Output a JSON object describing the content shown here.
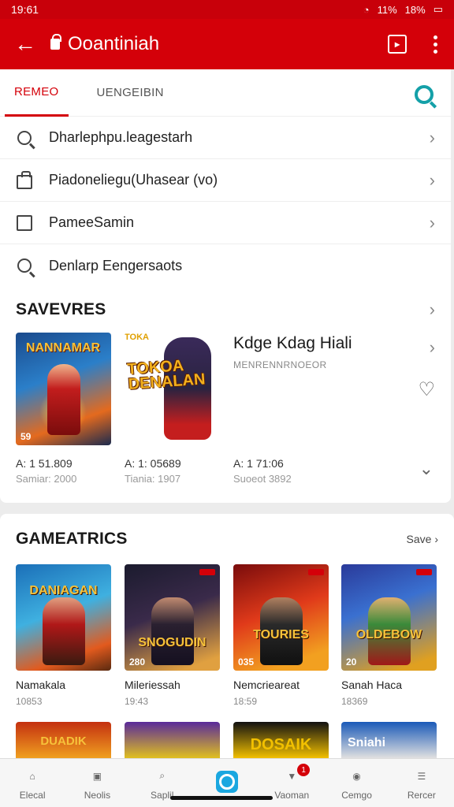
{
  "status": {
    "time": "19:61",
    "sig": "11%",
    "battery": "18%"
  },
  "appbar": {
    "title": "Ooantiniah"
  },
  "tabs": [
    {
      "label": "REMEO"
    },
    {
      "label": "UENGEIBIN"
    }
  ],
  "search_rows": [
    {
      "icon": "search-icon",
      "label": "Dharlephpu.leagestarh"
    },
    {
      "icon": "bag-icon",
      "label": "Piadoneliegu(Uhasear (vo)"
    },
    {
      "icon": "square-icon",
      "label": "PameeSamin"
    },
    {
      "icon": "search-icon",
      "label": "Denlarp Eengersaots"
    }
  ],
  "featured": {
    "heading": "SAVEVRES",
    "thumb1_title": "NANNAMAR",
    "thumb1_badge": "59",
    "thumb2_small": "TOKA",
    "thumb2_logo": "TOKOA DENALAN",
    "name": "Kdge Kdag Hiali",
    "subtitle": "MENRENNRNOEOR",
    "stats": [
      {
        "a": "A: 1 51.809",
        "b": "Samiar: 2000"
      },
      {
        "a": "A: 1: 05689",
        "b": "Tiania: 1907"
      },
      {
        "a": "A: 1 71:06",
        "b": "Suoeot 3892"
      }
    ]
  },
  "games": {
    "heading": "GAMEATRICS",
    "see_all": "Save",
    "items": [
      {
        "title": "DANIAGAN",
        "badge": "",
        "name": "Namakala",
        "sub": "10853",
        "bg": "linear-gradient(160deg,#1b6fb8,#3fb0e0 45%,#e25a1e 80%,#5a2a10)",
        "fig": "linear-gradient(180deg,#e0a080,#b01818 40%,#3a1a10)"
      },
      {
        "title": "SNOGUDIN",
        "badge": "280",
        "name": "Mileriessah",
        "sub": "19:43",
        "bg": "linear-gradient(160deg,#1b1b2e,#3a2a4a 45%,#e0a040 90%)",
        "fig": "linear-gradient(180deg,#c08a70,#2a2030 40%,#151020)"
      },
      {
        "title": "TOURIES",
        "badge": "035",
        "name": "Nemcrieareat",
        "sub": "18:59",
        "bg": "linear-gradient(160deg,#7a0c0c,#e03a1a 45%,#f2a020 85%)",
        "fig": "linear-gradient(180deg,#b08060,#2a2a2a 40%,#101010)"
      },
      {
        "title": "OLDEBOW",
        "badge": "20",
        "name": "Sanah Haca",
        "sub": "18369",
        "bg": "linear-gradient(160deg,#2a3a9a,#3a70d0 40%,#e0a020 90%)",
        "fig": "linear-gradient(180deg,#e0b070,#3a8a3a 40%,#a01818)"
      }
    ]
  },
  "strip": [
    {
      "bg": "linear-gradient(180deg,#c43010,#f0a020)"
    },
    {
      "bg": "linear-gradient(180deg,#5a2a9a,#e0c020)"
    },
    {
      "bg": "linear-gradient(180deg,#111,#f2c000)"
    },
    {
      "bg": "linear-gradient(180deg,#1a5ab8,#e0e0e0)"
    }
  ],
  "strip_labels": [
    "DUADIK",
    "",
    "DOSAIK",
    "Sniahi"
  ],
  "nav": [
    {
      "label": "Elecal",
      "icon": "home-icon"
    },
    {
      "label": "Neolis",
      "icon": "briefcase-icon"
    },
    {
      "label": "Saplil",
      "icon": "search-icon"
    },
    {
      "label": "",
      "icon": "discover-icon"
    },
    {
      "label": "Vaoman",
      "icon": "chat-icon",
      "badge": "1"
    },
    {
      "label": "Cemgo",
      "icon": "profile-icon"
    },
    {
      "label": "Rercer",
      "icon": "menu-icon"
    }
  ],
  "colors": {
    "primary": "#d40009",
    "accent": "#14a0a8",
    "nav_active": "#1aa7e0"
  }
}
